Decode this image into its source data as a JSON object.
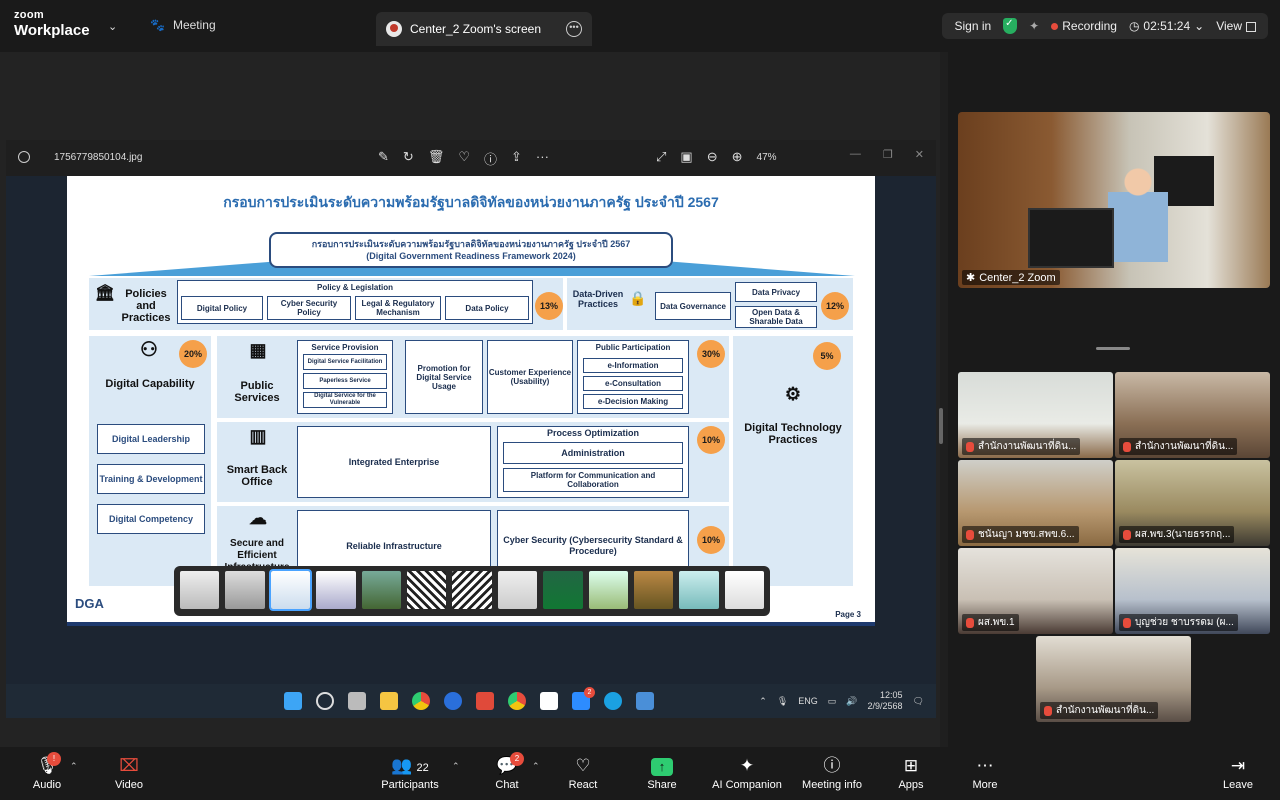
{
  "topbar": {
    "brand_top": "zoom",
    "brand_bottom": "Workplace",
    "meeting_label": "Meeting",
    "share_tab_title": "Center_2 Zoom's screen",
    "sign_in": "Sign in",
    "recording_label": "Recording",
    "timer": "02:51:24",
    "view_label": "View"
  },
  "viewer": {
    "filename": "1756779850104.jpg",
    "zoom_percent": "47%"
  },
  "slide": {
    "title": "กรอบการประเมินระดับความพร้อมรัฐบาลดิจิทัลของหน่วยงานภาครัฐ ประจำปี 2567",
    "roof_line1": "กรอบการประเมินระดับความพร้อมรัฐบาลดิจิทัลของหน่วยงานภาครัฐ ประจำปี 2567",
    "roof_line2": "(Digital Government Readiness Framework 2024)",
    "policies_label": "Policies and Practices",
    "policy_legislation": "Policy & Legislation",
    "digital_policy": "Digital Policy",
    "cyber_security_policy": "Cyber Security Policy",
    "legal_regulatory": "Legal & Regulatory Mechanism",
    "data_policy": "Data Policy",
    "pct_policies": "13%",
    "data_driven": "Data-Driven Practices",
    "data_governance": "Data Governance",
    "data_privacy": "Data Privacy",
    "open_data": "Open Data & Sharable Data",
    "pct_data": "12%",
    "digital_capability": "Digital Capability",
    "pct_capability": "20%",
    "digital_leadership": "Digital Leadership",
    "training_dev": "Training & Development",
    "digital_competency": "Digital Competency",
    "public_services": "Public Services",
    "service_provision": "Service Provision",
    "sp_facilitation": "Digital Service Facilitation",
    "sp_paperless": "Paperless Service",
    "sp_vulnerable": "Digital Service for the Vulnerable",
    "promotion": "Promotion for Digital Service Usage",
    "customer_exp": "Customer Experience (Usability)",
    "public_participation": "Public Participation",
    "e_information": "e-Information",
    "e_consultation": "e-Consultation",
    "e_decision": "e-Decision Making",
    "pct_public": "30%",
    "pct_tech": "5%",
    "digital_tech": "Digital Technology Practices",
    "smart_back_office": "Smart Back Office",
    "integrated_enterprise": "Integrated Enterprise",
    "process_optimization": "Process Optimization",
    "administration": "Administration",
    "platform_comm": "Platform for Communication and Collaboration",
    "pct_backoffice": "10%",
    "secure_infra": "Secure and Efficient Infrastructure",
    "reliable_infra": "Reliable Infrastructure",
    "cyber_security": "Cyber Security (Cybersecurity Standard & Procedure)",
    "pct_infra": "10%",
    "logo": "DGA",
    "page": "Page 3"
  },
  "taskbar": {
    "lang": "ENG",
    "time": "12:05",
    "date": "2/9/2568",
    "zoom_badge": "2"
  },
  "gallery": {
    "main_name": "Center_2 Zoom",
    "tiles": [
      {
        "name": "สำนักงานพัฒนาที่ดิน..."
      },
      {
        "name": "สำนักงานพัฒนาที่ดิน..."
      },
      {
        "name": "ชนันญา  มชข.สพข.6..."
      },
      {
        "name": "ผส.พข.3(นายธรรกฤ..."
      },
      {
        "name": "ผส.พข.1"
      },
      {
        "name": "บุญช่วย  ชาบรรดม (ผ..."
      },
      {
        "name": "สำนักงานพัฒนาที่ดิน..."
      }
    ]
  },
  "toolbar": {
    "audio": "Audio",
    "video": "Video",
    "participants": "Participants",
    "participants_count": "22",
    "chat": "Chat",
    "chat_badge": "2",
    "react": "React",
    "share": "Share",
    "ai_companion": "AI Companion",
    "meeting_info": "Meeting info",
    "apps": "Apps",
    "more": "More",
    "leave": "Leave"
  },
  "colors": {
    "accent_orange": "#f5a04a",
    "slide_blue": "#2b6cb0",
    "recording_red": "#e74c3c",
    "share_green": "#2ecc71"
  }
}
